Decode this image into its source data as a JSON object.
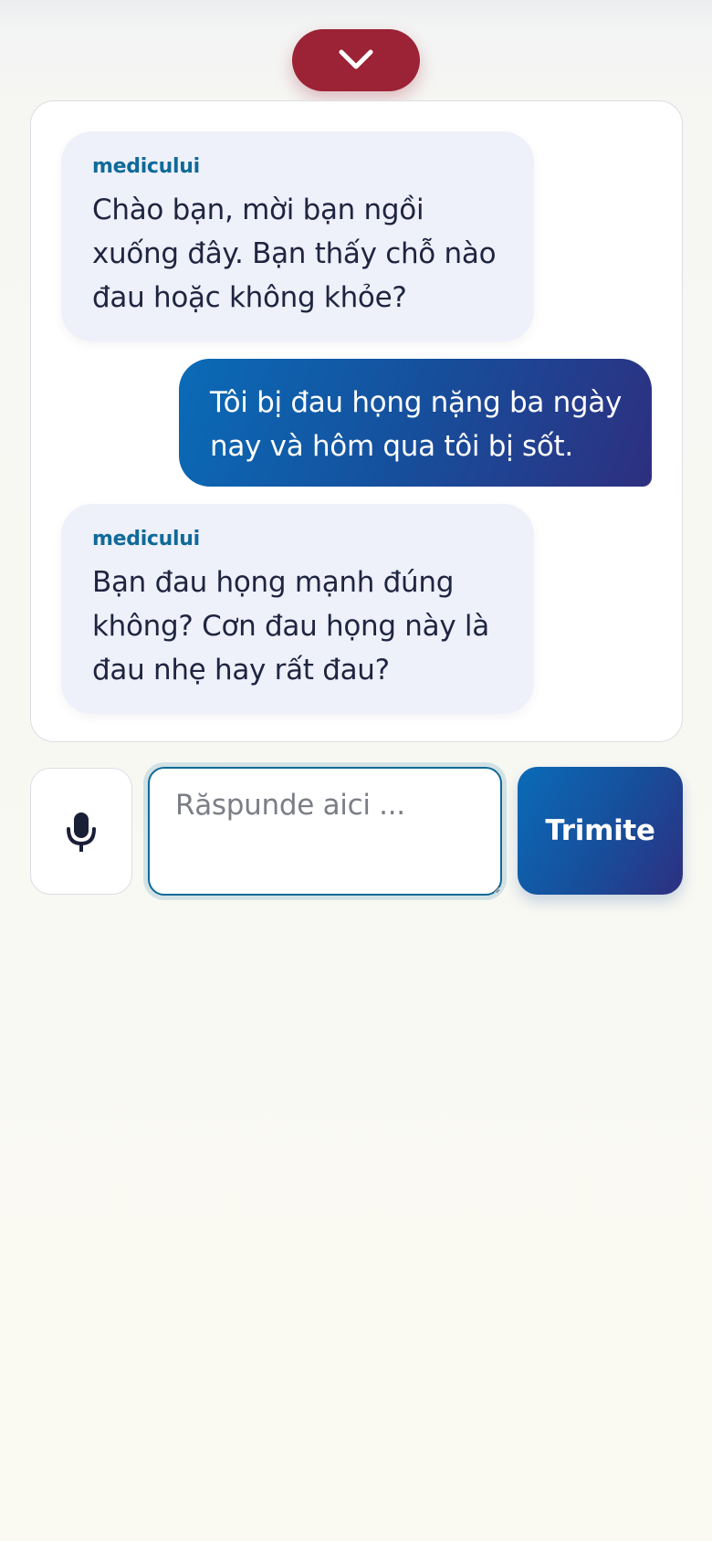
{
  "header": {
    "collapse_icon": "chevron-down-icon",
    "collapse_color": "#9c2235"
  },
  "chat": {
    "messages": [
      {
        "role": "bot",
        "sender": "medicului",
        "text": "Chào bạn, mời bạn ngồi xuống đây. Bạn thấy chỗ nào đau hoặc không khỏe?"
      },
      {
        "role": "user",
        "text": "Tôi bị đau họng nặng ba ngày nay và hôm qua tôi bị sốt."
      },
      {
        "role": "bot",
        "sender": "medicului",
        "text": "Bạn đau họng mạnh đúng không? Cơn đau họng này là đau nhẹ hay rất đau?"
      }
    ]
  },
  "composer": {
    "mic_icon": "microphone-icon",
    "placeholder": "Răspunde aici ...",
    "value": "",
    "send_label": "Trimite"
  },
  "colors": {
    "accent": "#0f6a98",
    "bot_bubble": "#eef0fa",
    "user_bubble_start": "#0a6bb7",
    "user_bubble_end": "#2e2f80",
    "collapse_button": "#9c2235"
  }
}
